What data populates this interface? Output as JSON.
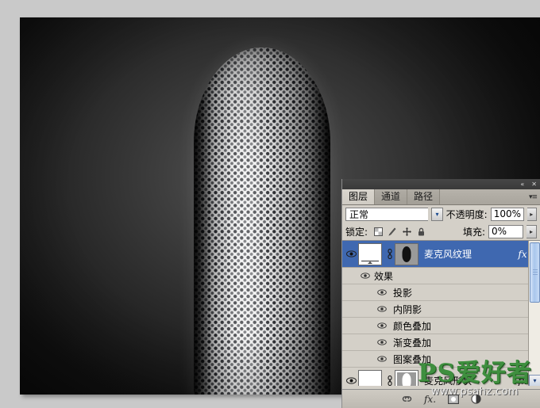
{
  "app": {
    "document_background": "#0a0a0a",
    "workspace_background": "#c9c9c9"
  },
  "artwork": {
    "subject": "microphone-mesh-grille",
    "description": "Chrome perforated microphone grille on dark gradient background"
  },
  "panel": {
    "titlebar": {
      "collapse_label": "«",
      "close_label": "✕"
    },
    "tabs": [
      {
        "label": "图层",
        "active": true
      },
      {
        "label": "通道",
        "active": false
      },
      {
        "label": "路径",
        "active": false
      }
    ],
    "menu_icon": "▾≡",
    "blend": {
      "mode_value": "正常",
      "dropdown_arrow": "▾",
      "opacity_label": "不透明度:",
      "opacity_value": "100%",
      "opacity_spin": "▸"
    },
    "lock": {
      "label": "锁定:",
      "icons": [
        "lock-transparency-icon",
        "lock-image-icon",
        "lock-position-icon",
        "lock-all-icon"
      ],
      "fill_label": "填充:",
      "fill_value": "0%",
      "fill_spin": "▸"
    },
    "layers": [
      {
        "name": "麦克风纹理",
        "selected": true,
        "visible": true,
        "fx": "fx",
        "disclosure": "▴",
        "mask_fill": "#111111",
        "mask_selected": false
      },
      {
        "name": "麦克风形状",
        "selected": false,
        "visible": true,
        "fx": "fx",
        "disclosure": "▴",
        "mask_fill": "#ffffff",
        "mask_selected": true
      }
    ],
    "effects": {
      "group_label": "效果",
      "items": [
        "投影",
        "内阴影",
        "颜色叠加",
        "渐变叠加",
        "图案叠加"
      ]
    },
    "scrollbar": {
      "down_arrow": "▾"
    },
    "bottom_toolbar": [
      "link-layers-icon",
      "add-layer-style-icon",
      "add-layer-mask-icon",
      "new-adjustment-layer-icon"
    ],
    "bottom_fx_label": "fx."
  },
  "watermark": {
    "brand": "PS爱好者",
    "url": "www.psahz.com",
    "color": "#3f8f3f"
  }
}
